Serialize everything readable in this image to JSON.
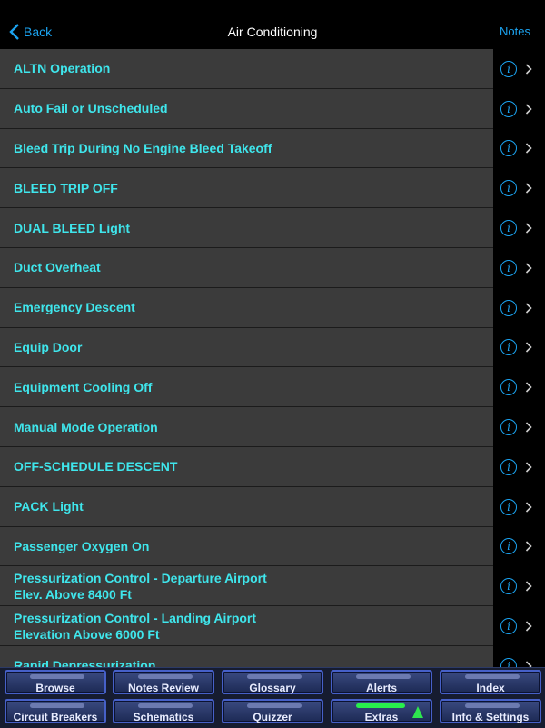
{
  "header": {
    "back_label": "Back",
    "title": "Air Conditioning",
    "notes_label": "Notes"
  },
  "items": [
    {
      "label": "ALTN Operation"
    },
    {
      "label": "Auto Fail or Unscheduled"
    },
    {
      "label": "Bleed Trip During No Engine Bleed Takeoff"
    },
    {
      "label": "BLEED TRIP OFF"
    },
    {
      "label": "DUAL BLEED Light"
    },
    {
      "label": "Duct Overheat"
    },
    {
      "label": "Emergency Descent"
    },
    {
      "label": "Equip Door"
    },
    {
      "label": "Equipment Cooling Off"
    },
    {
      "label": "Manual Mode Operation"
    },
    {
      "label": "OFF-SCHEDULE DESCENT"
    },
    {
      "label": "PACK Light"
    },
    {
      "label": "Passenger Oxygen On"
    },
    {
      "label": "Pressurization Control - Departure Airport\nElev. Above 8400 Ft"
    },
    {
      "label": "Pressurization Control - Landing Airport\nElevation Above 6000 Ft"
    },
    {
      "label": "Rapid Depressurization"
    }
  ],
  "toolbar": {
    "row1": [
      "Browse",
      "Notes Review",
      "Glossary",
      "Alerts",
      "Index"
    ],
    "row2": [
      "Circuit Breakers",
      "Schematics",
      "Quizzer",
      "Extras",
      "Info & Settings"
    ]
  },
  "colors": {
    "accent": "#1ba3f0",
    "item_text": "#3fe6ec",
    "row_bg": "#3b3b3b"
  }
}
